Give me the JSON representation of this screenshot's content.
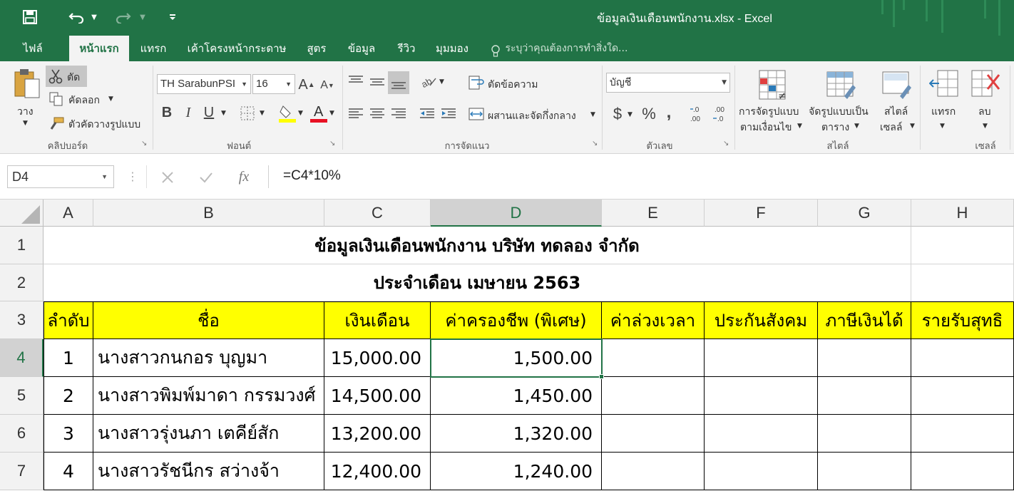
{
  "window": {
    "title": "ข้อมูลเงินเดือนพนักงาน.xlsx - Excel"
  },
  "tabs": [
    {
      "label": "ไฟล์"
    },
    {
      "label": "หน้าแรก"
    },
    {
      "label": "แทรก"
    },
    {
      "label": "เค้าโครงหน้ากระดาษ"
    },
    {
      "label": "สูตร"
    },
    {
      "label": "ข้อมูล"
    },
    {
      "label": "รีวิว"
    },
    {
      "label": "มุมมอง"
    }
  ],
  "tell_me": "ระบุว่าคุณต้องการทำสิ่งใด...",
  "ribbon": {
    "clipboard": {
      "paste": "วาง",
      "cut": "ตัด",
      "copy": "คัดลอก",
      "format_painter": "ตัวคัดวางรูปแบบ",
      "group": "คลิปบอร์ด"
    },
    "font": {
      "name": "TH SarabunPSI",
      "size": "16",
      "group": "ฟอนต์",
      "bold": "B",
      "italic": "I",
      "underline": "U"
    },
    "alignment": {
      "wrap": "ตัดข้อความ",
      "merge": "ผสานและจัดกึ่งกลาง",
      "group": "การจัดแนว"
    },
    "number": {
      "format": "บัญชี",
      "group": "ตัวเลข",
      "currency": "$",
      "percent": "%",
      "comma": ","
    },
    "styles": {
      "conditional_1": "การจัดรูปแบบ",
      "conditional_2": "ตามเงื่อนไข",
      "table_1": "จัดรูปแบบเป็น",
      "table_2": "ตาราง",
      "cell_1": "สไตล์",
      "cell_2": "เซลล์",
      "group": "สไตล์"
    },
    "cells": {
      "insert": "แทรก",
      "delete": "ลบ",
      "group": "เซลล์"
    }
  },
  "formula_bar": {
    "name_box": "D4",
    "fx": "fx",
    "formula": "=C4*10%"
  },
  "columns": [
    "A",
    "B",
    "C",
    "D",
    "E",
    "F",
    "G",
    "H"
  ],
  "rows": [
    "1",
    "2",
    "3",
    "4",
    "5",
    "6",
    "7"
  ],
  "sheet": {
    "title1": "ข้อมูลเงินเดือนพนักงาน บริษัท ทดลอง จำกัด",
    "title2": "ประจำเดือน เมษายน 2563",
    "headers": [
      "ลำดับ",
      "ชื่อ",
      "เงินเดือน",
      "ค่าครองชีพ (พิเศษ)",
      "ค่าล่วงเวลา",
      "ประกันสังคม",
      "ภาษีเงินได้",
      "รายรับสุทธิ"
    ],
    "data": [
      {
        "no": "1",
        "name": "นางสาวกนกอร  บุญมา",
        "salary": "15,000.00",
        "allowance": "1,500.00"
      },
      {
        "no": "2",
        "name": "นางสาวพิมพ์มาดา กรรมวงศ์",
        "salary": "14,500.00",
        "allowance": "1,450.00"
      },
      {
        "no": "3",
        "name": "นางสาวรุ่งนภา เตคีย์สัก",
        "salary": "13,200.00",
        "allowance": "1,320.00"
      },
      {
        "no": "4",
        "name": "นางสาวรัชนีกร  สว่างจ้า",
        "salary": "12,400.00",
        "allowance": "1,240.00"
      }
    ]
  },
  "colors": {
    "excel_green": "#217346",
    "header_fill": "#ffff00"
  }
}
